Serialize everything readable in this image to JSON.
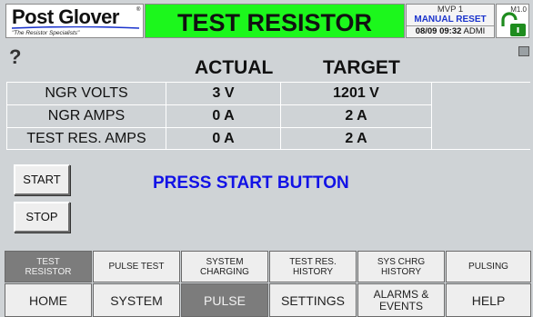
{
  "header": {
    "brand": "Post Glover",
    "brand_mark": "®",
    "tagline": "\"The Resistor Specialists\"",
    "title": "TEST RESISTOR",
    "device": "MVP 1",
    "mode": "MANUAL RESET",
    "date": "08/09",
    "time": "09:32",
    "user": "ADMI",
    "version": "M1.0",
    "lock_color": "#1e8c1e"
  },
  "help_label": "?",
  "columns": {
    "actual": "ACTUAL",
    "target": "TARGET"
  },
  "readings": [
    {
      "label": "NGR VOLTS",
      "actual": "3 V",
      "target": "1201 V"
    },
    {
      "label": "NGR AMPS",
      "actual": "0 A",
      "target": "2 A"
    },
    {
      "label": "TEST RES. AMPS",
      "actual": "0 A",
      "target": "2 A"
    }
  ],
  "controls": {
    "start": "START",
    "stop": "STOP"
  },
  "message": "PRESS START BUTTON",
  "colors": {
    "title_bg": "#1cf71c",
    "message": "#1212e6",
    "panel_bg": "#cfd3d6",
    "active_tab": "#7c7c7c"
  },
  "sub_tabs": [
    {
      "label_1": "TEST",
      "label_2": "RESISTOR",
      "active": true
    },
    {
      "label_1": "PULSE TEST",
      "label_2": ""
    },
    {
      "label_1": "SYSTEM",
      "label_2": "CHARGING"
    },
    {
      "label_1": "TEST RES.",
      "label_2": "HISTORY"
    },
    {
      "label_1": "SYS CHRG",
      "label_2": "HISTORY"
    },
    {
      "label_1": "PULSING",
      "label_2": ""
    }
  ],
  "main_tabs": [
    {
      "label_1": "HOME",
      "label_2": ""
    },
    {
      "label_1": "SYSTEM",
      "label_2": ""
    },
    {
      "label_1": "PULSE",
      "label_2": "",
      "active": true
    },
    {
      "label_1": "SETTINGS",
      "label_2": ""
    },
    {
      "label_1": "ALARMS &",
      "label_2": "EVENTS"
    },
    {
      "label_1": "HELP",
      "label_2": ""
    }
  ]
}
